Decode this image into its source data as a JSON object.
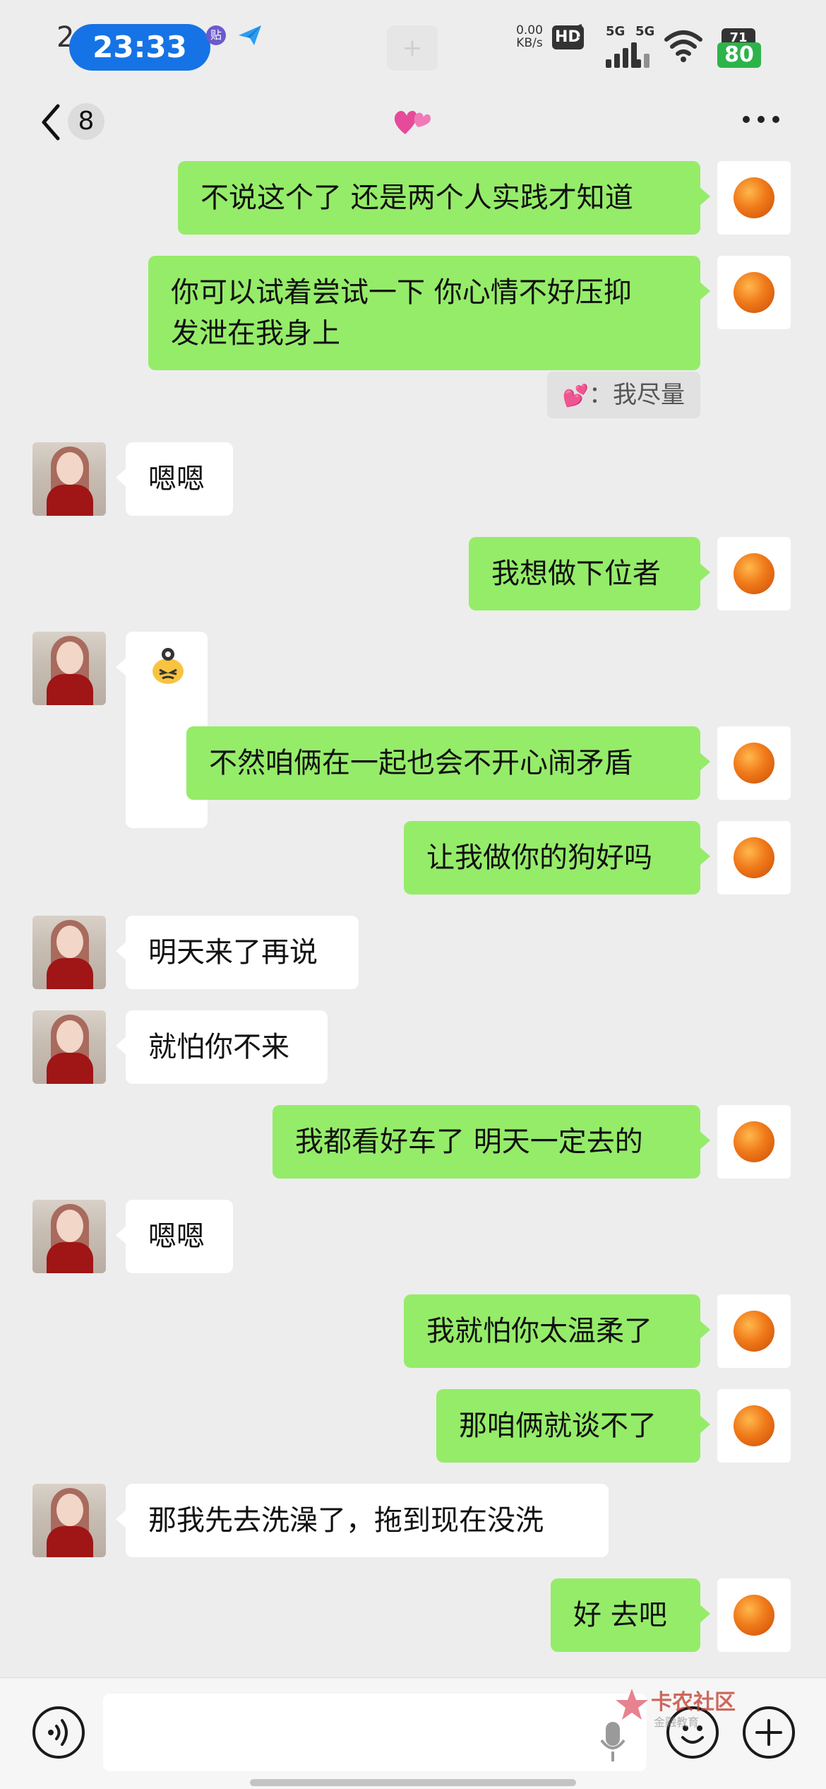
{
  "status_bar": {
    "leading_digit": "2",
    "time": "23:33",
    "net_speed_value": "0.00",
    "net_speed_unit": "KB/s",
    "hd_label": "HD",
    "hd_sub_top": "1",
    "hd_sub_bottom": "2",
    "signal_1_label": "5G",
    "signal_2_label": "5G",
    "battery_level": "71",
    "battery_percent": "80",
    "app_badge_label": "贴"
  },
  "nav": {
    "unread_count": "8"
  },
  "messages": [
    {
      "sender": "me",
      "text": "不说这个了 还是两个人实践才知道"
    },
    {
      "sender": "me",
      "text": "你可以试着尝试一下 你心情不好压抑\n发泄在我身上"
    },
    {
      "sender": "quote",
      "text": "：我尽量"
    },
    {
      "sender": "her",
      "text": "嗯嗯"
    },
    {
      "sender": "me",
      "text": "我想做下位者"
    },
    {
      "sender": "her",
      "text": "",
      "sticker": "wincing-face-sticker"
    },
    {
      "sender": "me",
      "text": "不然咱俩在一起也会不开心闹矛盾"
    },
    {
      "sender": "me",
      "text": "让我做你的狗好吗"
    },
    {
      "sender": "her",
      "text": "明天来了再说"
    },
    {
      "sender": "her",
      "text": "就怕你不来"
    },
    {
      "sender": "me",
      "text": "我都看好车了 明天一定去的"
    },
    {
      "sender": "her",
      "text": "嗯嗯"
    },
    {
      "sender": "me",
      "text": "我就怕你太温柔了"
    },
    {
      "sender": "me",
      "text": "那咱俩就谈不了"
    },
    {
      "sender": "her",
      "text": "那我先去洗澡了，拖到现在没洗"
    },
    {
      "sender": "me",
      "text": "好 去吧"
    }
  ],
  "watermark": {
    "title": "卡农社区",
    "subtitle": "金融教育"
  },
  "colors": {
    "my_bubble": "#95ec69",
    "her_bubble": "#ffffff",
    "background": "#ededed",
    "time_pill": "#1673e5",
    "battery_green": "#2db34a"
  }
}
